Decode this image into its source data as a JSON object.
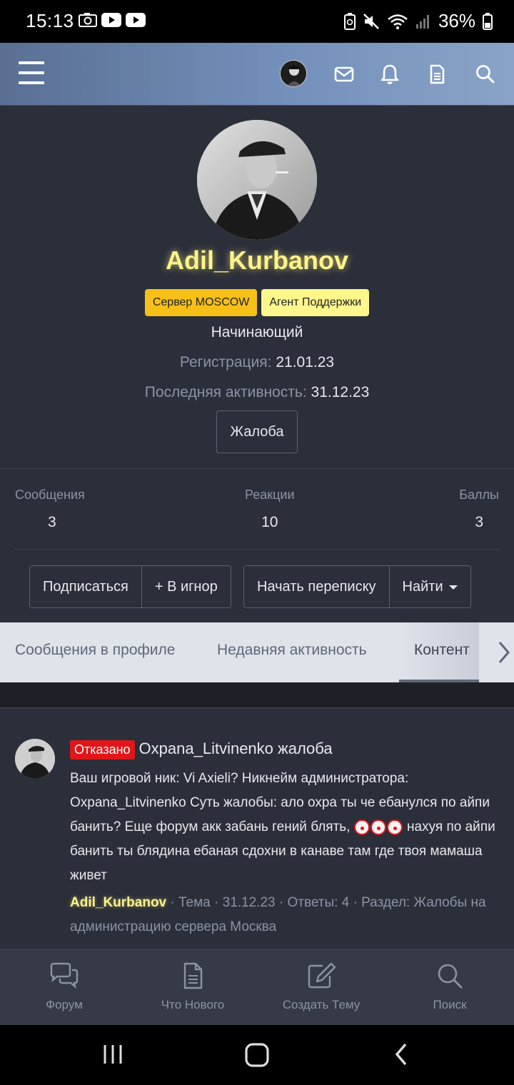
{
  "status_bar": {
    "time": "15:13",
    "battery": "36%",
    "icons": [
      "camera-icon",
      "youtube-icon",
      "youtube-icon",
      "battery-saver-icon",
      "mute-icon",
      "wifi-icon",
      "signal-icon",
      "battery-icon"
    ]
  },
  "header": {
    "icons": [
      "menu-icon",
      "avatar",
      "mail-icon",
      "bell-icon",
      "document-icon",
      "search-icon"
    ]
  },
  "profile": {
    "username": "Adil_Kurbanov",
    "badges": [
      "Сервер MOSCOW",
      "Агент Поддержки"
    ],
    "rank": "Начинающий",
    "registration_label": "Регистрация:",
    "registration_value": "21.01.23",
    "last_activity_label": "Последняя активность:",
    "last_activity_value": "31.12.23",
    "report_button": "Жалоба"
  },
  "stats": {
    "messages_label": "Сообщения",
    "messages_value": "3",
    "reactions_label": "Реакции",
    "reactions_value": "10",
    "points_label": "Баллы",
    "points_value": "3"
  },
  "actions": {
    "follow": "Подписаться",
    "ignore": "+ В игнор",
    "start_conversation": "Начать переписку",
    "find": "Найти"
  },
  "tabs": {
    "profile_posts": "Сообщения в профиле",
    "recent_activity": "Недавняя активность",
    "content": "Контент"
  },
  "post": {
    "status": "Отказано",
    "title": "Oxpana_Litvinenko жалоба",
    "body_text": "Ваш игровой ник: Vi Axieli? Никнейм администратора: Oxpana_Litvinenko Суть жалобы: ало охра ты че ебанулся по айпи банить? Еще форум акк забань гений блять,",
    "body_text_2": "нахуя по айпи банить ты блядина ебаная сдохни в канаве там где твоя мамаша живет",
    "author": "Adil_Kurbanov",
    "meta": " · Тема · 31.12.23 · Ответы: 4 · Раздел: Жалобы на администрацию сервера Москва"
  },
  "bottom_nav": {
    "forum": "Форум",
    "whats_new": "Что Нового",
    "create_thread": "Создать Тему",
    "search": "Поиск"
  },
  "colors": {
    "background": "#2b2f3a",
    "username_glow": "#fff38a",
    "badge_server": "#f6c018",
    "badge_support": "#fff68c",
    "status_rejected": "#e0161b"
  }
}
